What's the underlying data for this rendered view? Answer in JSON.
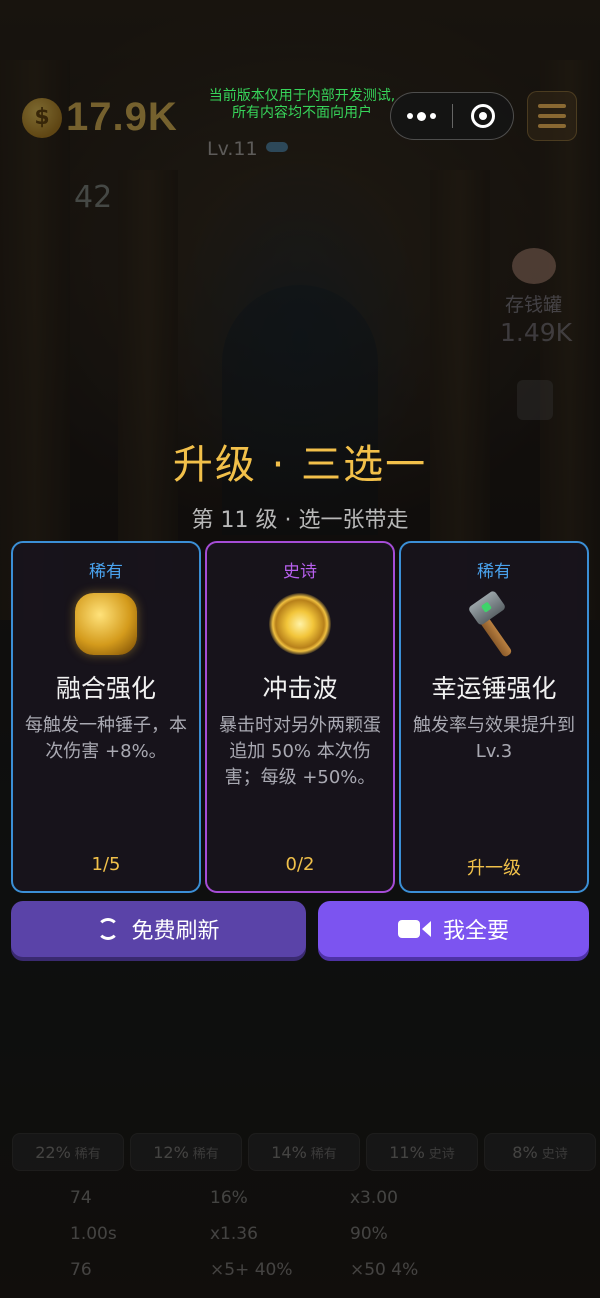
{
  "hud": {
    "coins": "17.9K",
    "coin_symbol": "$",
    "level": "Lv.11",
    "stat_value": "42",
    "dev_notice_line1": "当前版本仅用于内部开发测试,",
    "dev_notice_line2": "所有内容均不面向用户",
    "bank_label": "存钱罐",
    "bank_value": "1.49K"
  },
  "screen": {
    "title": "升级 · 三选一",
    "subtitle": "第 11 级 · 选一张带走"
  },
  "cards": [
    {
      "rarity": "稀有",
      "name": "融合强化",
      "desc": "每触发一种锤子，本次伤害 +8%。",
      "footer": "1/5",
      "icon": "gold-nugget-icon"
    },
    {
      "rarity": "史诗",
      "name": "冲击波",
      "desc": "暴击时对另外两颗蛋追加 50% 本次伤害；每级 +50%。",
      "footer": "0/2",
      "icon": "shockwave-icon"
    },
    {
      "rarity": "稀有",
      "name": "幸运锤强化",
      "desc": "触发率与效果提升到 Lv.3",
      "footer": "升一级",
      "icon": "hammer-icon"
    }
  ],
  "actions": {
    "refresh_label": "免费刷新",
    "take_all_label": "我全要"
  },
  "bottom": {
    "chips": [
      {
        "value": "22%",
        "tag": "稀有"
      },
      {
        "value": "12%",
        "tag": "稀有"
      },
      {
        "value": "14%",
        "tag": "稀有"
      },
      {
        "value": "11%",
        "tag": "史诗"
      },
      {
        "value": "8%",
        "tag": "史诗"
      }
    ],
    "stats": [
      [
        "74",
        "16%",
        "x3.00"
      ],
      [
        "1.00s",
        "x1.36",
        "90%"
      ],
      [
        "76",
        "×5+ 40%",
        "×50 4%"
      ]
    ]
  },
  "colors": {
    "title": "#f2c04a",
    "rare": "#3b8fd6",
    "epic": "#a54cd6",
    "refresh_button": "#5a43a8",
    "take_all_button": "#7c54f0"
  }
}
